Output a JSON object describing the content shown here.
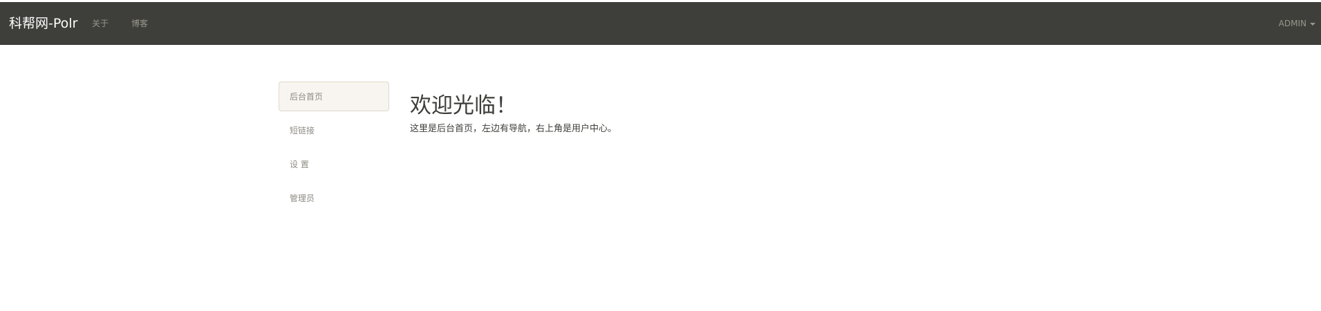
{
  "navbar": {
    "brand": "科帮网-Polr",
    "links": [
      "关于",
      "博客"
    ],
    "user": "ADMIN"
  },
  "sidebar": {
    "items": [
      {
        "label": "后台首页",
        "active": true
      },
      {
        "label": "短链接",
        "active": false
      },
      {
        "label": "设 置",
        "active": false
      },
      {
        "label": "管理员",
        "active": false
      }
    ]
  },
  "main": {
    "title": "欢迎光临！",
    "description": "这里是后台首页，左边有导航，右上角是用户中心。"
  },
  "colors": {
    "navbar_bg": "#3e3f3a",
    "active_bg": "#f8f5f0",
    "active_border": "#dfd7ca",
    "muted_text": "#98978b"
  }
}
